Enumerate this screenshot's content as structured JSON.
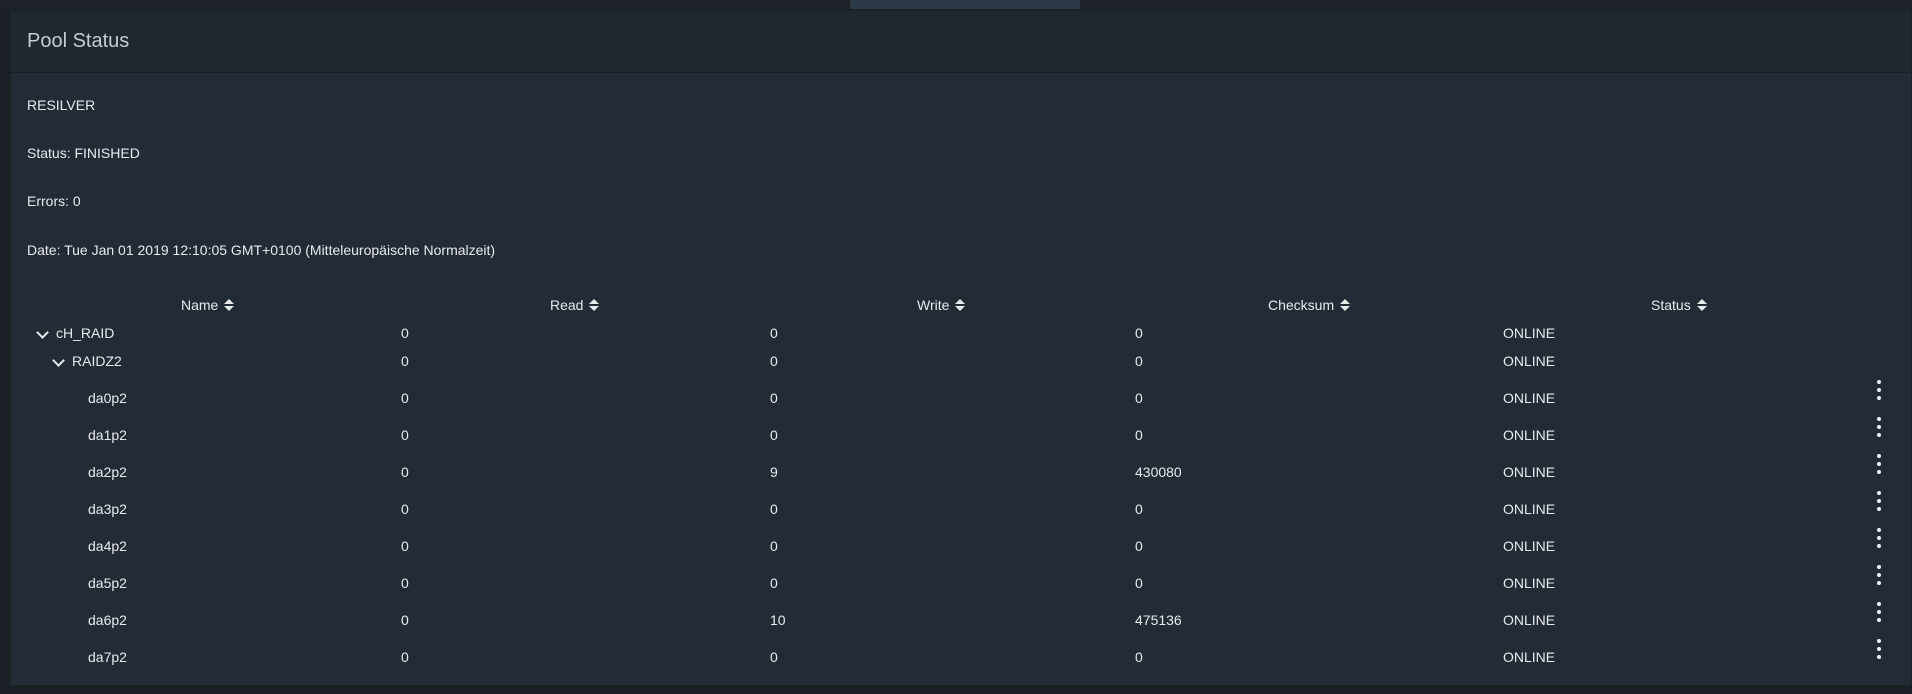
{
  "card": {
    "title": "Pool Status"
  },
  "scan": {
    "type": "RESILVER",
    "status": "Status: FINISHED",
    "errors": "Errors: 0",
    "date": "Date: Tue Jan 01 2019 12:10:05 GMT+0100 (Mitteleuropäische Normalzeit)"
  },
  "table": {
    "columns": [
      "Name",
      "Read",
      "Write",
      "Checksum",
      "Status"
    ],
    "rows": [
      {
        "name": "cH_RAID",
        "read": "0",
        "write": "0",
        "checksum": "0",
        "status": "ONLINE",
        "level": 0,
        "expandable": true,
        "menu": false
      },
      {
        "name": "RAIDZ2",
        "read": "0",
        "write": "0",
        "checksum": "0",
        "status": "ONLINE",
        "level": 1,
        "expandable": true,
        "menu": false
      },
      {
        "name": "da0p2",
        "read": "0",
        "write": "0",
        "checksum": "0",
        "status": "ONLINE",
        "level": 2,
        "expandable": false,
        "menu": true
      },
      {
        "name": "da1p2",
        "read": "0",
        "write": "0",
        "checksum": "0",
        "status": "ONLINE",
        "level": 2,
        "expandable": false,
        "menu": true
      },
      {
        "name": "da2p2",
        "read": "0",
        "write": "9",
        "checksum": "430080",
        "status": "ONLINE",
        "level": 2,
        "expandable": false,
        "menu": true
      },
      {
        "name": "da3p2",
        "read": "0",
        "write": "0",
        "checksum": "0",
        "status": "ONLINE",
        "level": 2,
        "expandable": false,
        "menu": true
      },
      {
        "name": "da4p2",
        "read": "0",
        "write": "0",
        "checksum": "0",
        "status": "ONLINE",
        "level": 2,
        "expandable": false,
        "menu": true
      },
      {
        "name": "da5p2",
        "read": "0",
        "write": "0",
        "checksum": "0",
        "status": "ONLINE",
        "level": 2,
        "expandable": false,
        "menu": true
      },
      {
        "name": "da6p2",
        "read": "0",
        "write": "10",
        "checksum": "475136",
        "status": "ONLINE",
        "level": 2,
        "expandable": false,
        "menu": true
      },
      {
        "name": "da7p2",
        "read": "0",
        "write": "0",
        "checksum": "0",
        "status": "ONLINE",
        "level": 2,
        "expandable": false,
        "menu": true
      }
    ]
  },
  "icons": {
    "sort": "sort-icon",
    "expand": "chevron-down-icon",
    "menu": "more-vertical-icon"
  }
}
